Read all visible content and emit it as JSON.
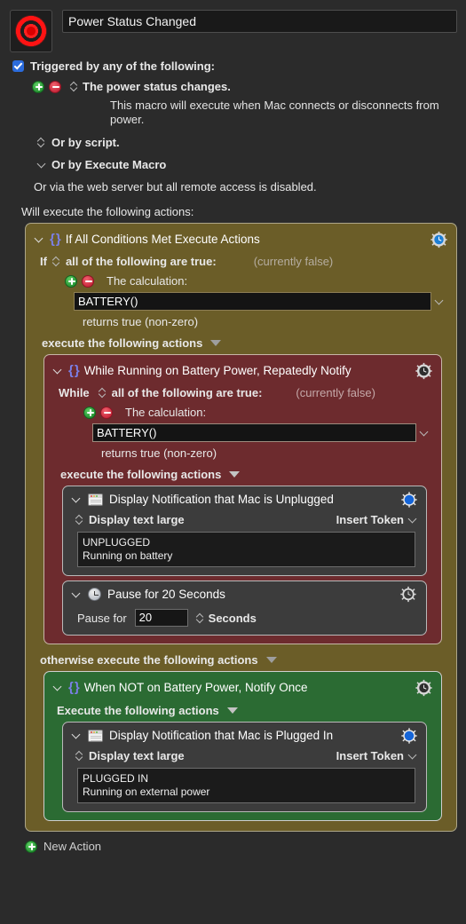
{
  "macro": {
    "icon": "bullseye-record-icon",
    "name": "Power Status Changed"
  },
  "triggers": {
    "checkbox_checked": true,
    "label": "Triggered by any of the following:",
    "trigger_item": "The power status changes.",
    "description": "This macro will execute when Mac connects or disconnects from power.",
    "or_script": "Or by script.",
    "or_execute_macro": "Or by Execute Macro",
    "or_web": "Or via the web server but all remote access is disabled."
  },
  "actions_header": "Will execute the following actions:",
  "if_block": {
    "title": "If All Conditions Met Execute Actions",
    "if_word": "If",
    "condition_mode": "all of the following are true:",
    "current_state": "(currently false)",
    "calculation_label": "The calculation:",
    "calculation_value": "BATTERY()",
    "returns": "returns true (non-zero)",
    "execute_label": "execute the following actions",
    "otherwise_label": "otherwise execute the following actions",
    "color": "#6b5d28"
  },
  "while_block": {
    "title": "While Running on Battery Power, Repatedly Notify",
    "while_word": "While",
    "condition_mode": "all of the following are true:",
    "current_state": "(currently false)",
    "calculation_label": "The calculation:",
    "calculation_value": "BATTERY()",
    "returns": "returns true (non-zero)",
    "execute_label": "execute the following actions",
    "color": "#6d2b2e",
    "actions": [
      {
        "title": "Display Notification that Mac is Unplugged",
        "icon": "notification-window-icon",
        "display_mode": "Display text large",
        "insert_token": "Insert Token",
        "text": "UNPLUGGED\nRunning on battery",
        "text_line1": "UNPLUGGED",
        "text_line2": "Running on battery"
      },
      {
        "title": "Pause for 20 Seconds",
        "icon": "clock-icon",
        "pause_label": "Pause for",
        "pause_value": "20",
        "pause_units": "Seconds"
      }
    ]
  },
  "else_block": {
    "title": "When NOT on Battery Power, Notify Once",
    "execute_label": "Execute the following actions",
    "color": "#2b6b33",
    "actions": [
      {
        "title": "Display Notification that Mac is Plugged In",
        "icon": "notification-window-icon",
        "display_mode": "Display text large",
        "insert_token": "Insert Token",
        "text_line1": "PLUGGED IN",
        "text_line2": "Running on external power"
      }
    ]
  },
  "footer": {
    "new_action": "New Action"
  }
}
